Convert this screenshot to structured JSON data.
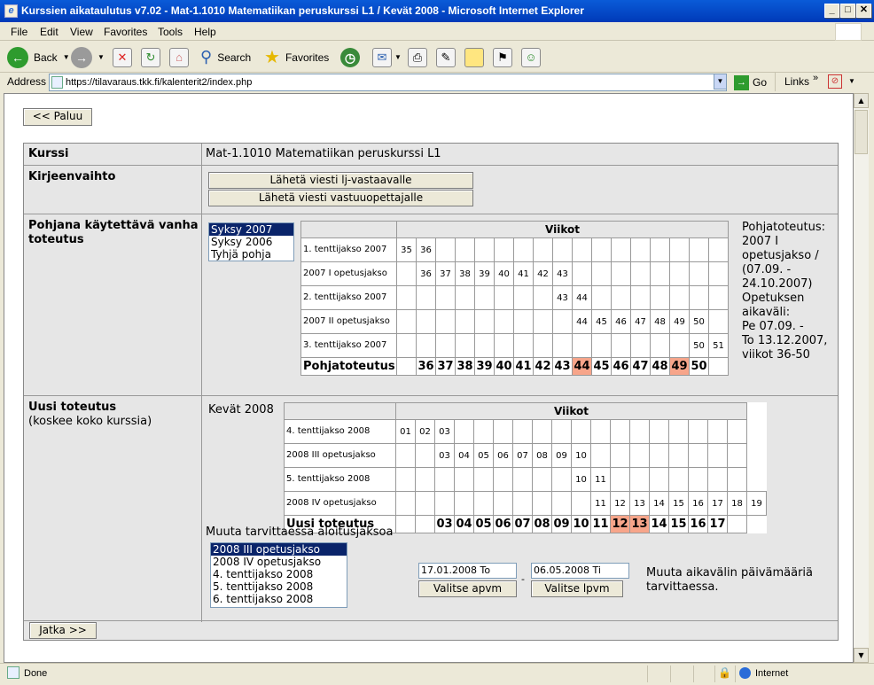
{
  "window": {
    "title": "Kurssien aikataulutus v7.02 - Mat-1.1010 Matematiikan peruskurssi L1 / Kevät 2008 - Microsoft Internet Explorer"
  },
  "menu": [
    "File",
    "Edit",
    "View",
    "Favorites",
    "Tools",
    "Help"
  ],
  "toolbar": {
    "back": "Back",
    "search": "Search",
    "favorites": "Favorites"
  },
  "address": {
    "label": "Address",
    "url": "https://tilavaraus.tkk.fi/kalenterit2/index.php",
    "go": "Go",
    "links": "Links"
  },
  "status": {
    "text": "Done",
    "zone": "Internet"
  },
  "page": {
    "back_button": "<< Paluu",
    "next_button": "Jatka >>",
    "course": {
      "label": "Kurssi",
      "value": "Mat-1.1010 Matematiikan peruskurssi L1"
    },
    "messaging": {
      "label": "Kirjeenvaihto",
      "btn_lj": "Lähetä viesti lj-vastaavalle",
      "btn_teacher": "Lähetä viesti vastuuopettajalle"
    },
    "base": {
      "label": "Pohjana käytettävä vanha toteutus",
      "options": [
        {
          "label": "Syksy 2007",
          "selected": true
        },
        {
          "label": "Syksy 2006",
          "selected": false
        },
        {
          "label": "Tyhjä pohja",
          "selected": false
        }
      ],
      "weeks_header": "Viikot",
      "rows": [
        {
          "label": "1. tenttijakso 2007",
          "cells": [
            "35",
            "36",
            "",
            "",
            "",
            "",
            "",
            "",
            "",
            "",
            "",
            "",
            "",
            "",
            "",
            "",
            ""
          ]
        },
        {
          "label": "2007 I opetusjakso",
          "cells": [
            "",
            "36",
            "37",
            "38",
            "39",
            "40",
            "41",
            "42",
            "43",
            "",
            "",
            "",
            "",
            "",
            "",
            "",
            ""
          ]
        },
        {
          "label": "2. tenttijakso 2007",
          "cells": [
            "",
            "",
            "",
            "",
            "",
            "",
            "",
            "",
            "43",
            "44",
            "",
            "",
            "",
            "",
            "",
            "",
            ""
          ]
        },
        {
          "label": "2007 II opetusjakso",
          "cells": [
            "",
            "",
            "",
            "",
            "",
            "",
            "",
            "",
            "",
            "44",
            "45",
            "46",
            "47",
            "48",
            "49",
            "50",
            ""
          ]
        },
        {
          "label": "3. tenttijakso 2007",
          "cells": [
            "",
            "",
            "",
            "",
            "",
            "",
            "",
            "",
            "",
            "",
            "",
            "",
            "",
            "",
            "",
            "50",
            "51"
          ]
        }
      ],
      "summary": {
        "label": "Pohjatoteutus",
        "cells": [
          "",
          "36",
          "37",
          "38",
          "39",
          "40",
          "41",
          "42",
          "43",
          "44",
          "45",
          "46",
          "47",
          "48",
          "49",
          "50",
          ""
        ],
        "highlight": [
          9,
          14
        ]
      },
      "info": [
        "Pohjatoteutus:",
        "2007 I",
        "opetusjakso /",
        "(07.09. -",
        "24.10.2007)",
        "Opetuksen",
        "aikaväli:",
        "Pe 07.09. -",
        "To 13.12.2007,",
        "viikot 36-50"
      ]
    },
    "new": {
      "label": "Uusi toteutus",
      "sublabel": "(koskee koko kurssia)",
      "term": "Kevät 2008",
      "weeks_header": "Viikot",
      "rows": [
        {
          "label": "4. tenttijakso 2008",
          "cells": [
            "01",
            "02",
            "03",
            "",
            "",
            "",
            "",
            "",
            "",
            "",
            "",
            "",
            "",
            "",
            "",
            "",
            "",
            ""
          ]
        },
        {
          "label": "2008 III opetusjakso",
          "cells": [
            "",
            "",
            "03",
            "04",
            "05",
            "06",
            "07",
            "08",
            "09",
            "10",
            "",
            "",
            "",
            "",
            "",
            "",
            "",
            ""
          ]
        },
        {
          "label": "5. tenttijakso 2008",
          "cells": [
            "",
            "",
            "",
            "",
            "",
            "",
            "",
            "",
            "",
            "10",
            "11",
            "",
            "",
            "",
            "",
            "",
            "",
            ""
          ]
        },
        {
          "label": "2008 IV opetusjakso",
          "cells": [
            "",
            "",
            "",
            "",
            "",
            "",
            "",
            "",
            "",
            "",
            "11",
            "12",
            "13",
            "14",
            "15",
            "16",
            "17",
            "18",
            "19"
          ]
        }
      ],
      "summary": {
        "label": "Uusi toteutus",
        "cells": [
          "",
          "",
          "03",
          "04",
          "05",
          "06",
          "07",
          "08",
          "09",
          "10",
          "11",
          "12",
          "13",
          "14",
          "15",
          "16",
          "17",
          ""
        ],
        "highlight": [
          11,
          12
        ]
      },
      "change_start_label": "Muuta tarvittaessa aloitusjaksoa",
      "periods": [
        {
          "label": "2008 III opetusjakso",
          "selected": true
        },
        {
          "label": "2008 IV opetusjakso",
          "selected": false
        },
        {
          "label": "4. tenttijakso 2008",
          "selected": false
        },
        {
          "label": "5. tenttijakso 2008",
          "selected": false
        },
        {
          "label": "6. tenttijakso 2008",
          "selected": false
        }
      ],
      "start_date": "17.01.2008 To",
      "end_date": "06.05.2008 Ti",
      "date_dash": "-",
      "choose_start": "Valitse apvm",
      "choose_end": "Valitse lpvm",
      "date_note": [
        "Muuta aikavälin päivämääriä",
        "tarvittaessa."
      ]
    }
  }
}
